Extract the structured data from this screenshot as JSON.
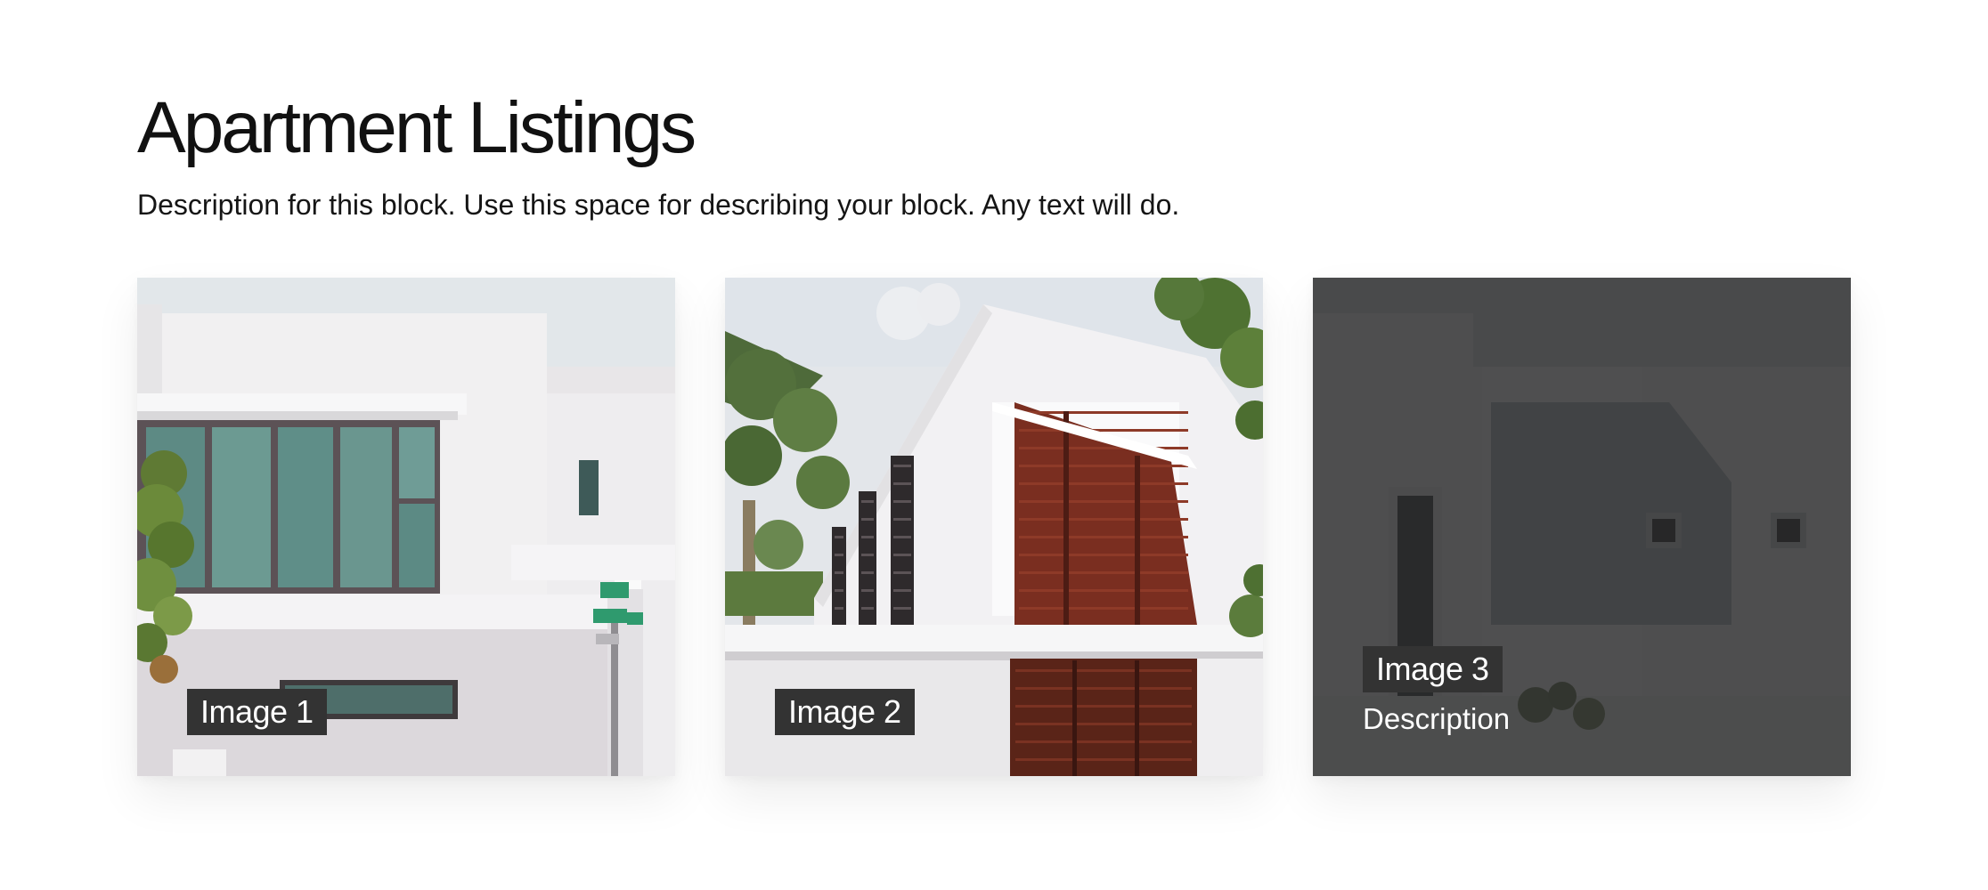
{
  "header": {
    "title": "Apartment Listings",
    "description": "Description for this block. Use this space for describing your block. Any text will do."
  },
  "cards": [
    {
      "label": "Image 1",
      "image": "white-modern-house-teal-windows-photo"
    },
    {
      "label": "Image 2",
      "image": "white-house-wooden-louvers-palm-photo"
    },
    {
      "label": "Image 3",
      "description": "Description",
      "image": "white-house-facade-photo",
      "state": "hover-dark-overlay"
    }
  ],
  "colors": {
    "caption_bg": "#333333",
    "overlay": "#262626",
    "text": "#111111"
  }
}
